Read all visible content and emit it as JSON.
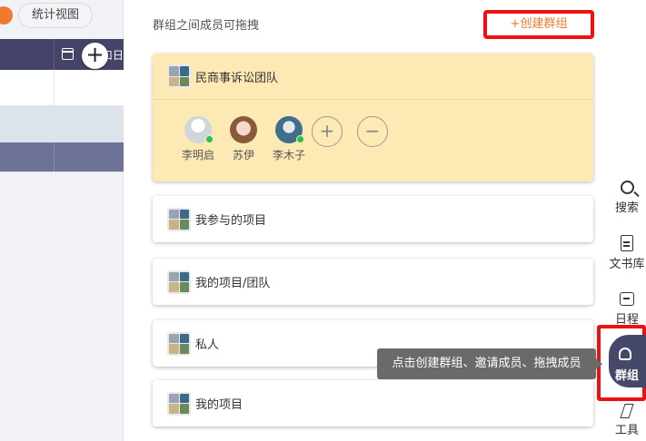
{
  "left": {
    "view_tab": "统计视图",
    "grid_header_text": "口日"
  },
  "panel": {
    "hint": "群组之间成员可拖拽",
    "create_group": "+创建群组",
    "groups": [
      {
        "title": "民商事诉讼团队",
        "members": [
          {
            "name": "李明启",
            "online": true
          },
          {
            "name": "苏伊",
            "online": false
          },
          {
            "name": "李木子",
            "online": true
          }
        ],
        "add_symbol": "+",
        "remove_symbol": "−"
      },
      {
        "title": "我参与的项目"
      },
      {
        "title": "我的项目/团队"
      },
      {
        "title": "私人"
      },
      {
        "title": "我的项目"
      }
    ]
  },
  "rail": {
    "search": "搜索",
    "docs": "文书库",
    "schedule": "日程",
    "groups": "群组",
    "tools": "工具"
  },
  "tooltip": "点击创建群组、邀请成员、拖拽成员",
  "colors": {
    "accent_orange": "#ee7a2e",
    "highlight_red": "#ee1111",
    "header_navy": "#434468",
    "group_card_yellow": "#fde9b4",
    "online_green": "#26c24a"
  }
}
